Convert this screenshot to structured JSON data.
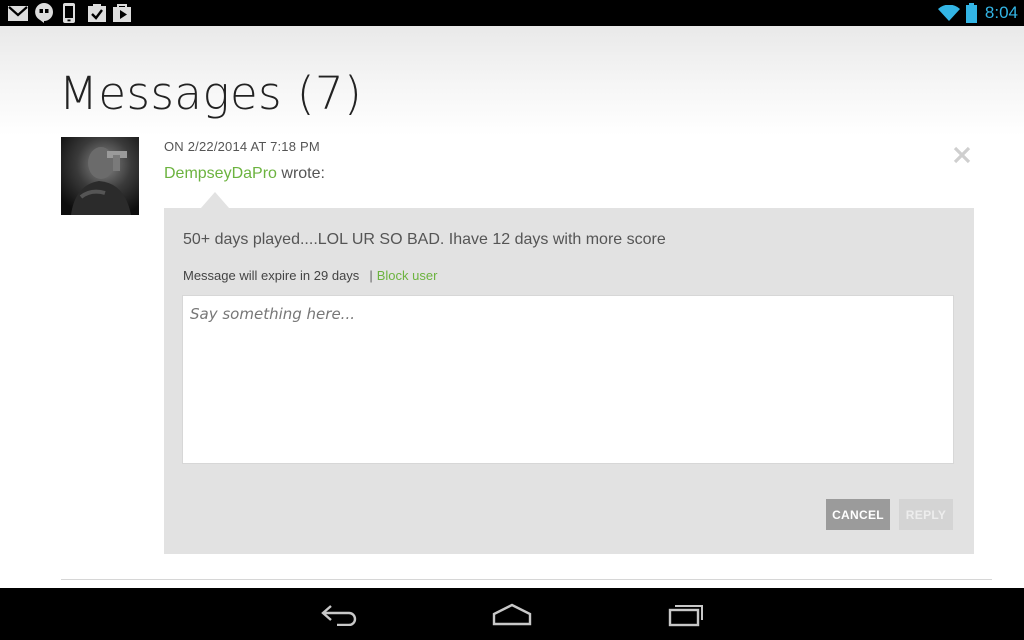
{
  "status_bar": {
    "time": "8:04",
    "notification_icons": [
      "gmail-icon",
      "hangouts-icon",
      "phone-icon",
      "clipboard-check-icon",
      "play-store-icon"
    ],
    "system_icons": [
      "wifi-icon",
      "battery-icon"
    ],
    "accent_color": "#33b5e5"
  },
  "page": {
    "title": "Messages (7)"
  },
  "message": {
    "date": "ON 2/22/2014 AT 7:18 PM",
    "author": "DempseyDaPro",
    "wrote_suffix": " wrote:",
    "body": "50+ days played....LOL UR SO BAD. Ihave 12 days with more score",
    "expiry": "Message will expire in 29 days",
    "separator": "|",
    "block_user_label": "Block user",
    "reply_placeholder": "Say something here...",
    "reply_value": "",
    "cancel_label": "CANCEL",
    "reply_label": "REPLY",
    "accent_color": "#6cb33f"
  },
  "nav_bar": {
    "buttons": [
      "back-icon",
      "home-icon",
      "recent-apps-icon"
    ]
  }
}
